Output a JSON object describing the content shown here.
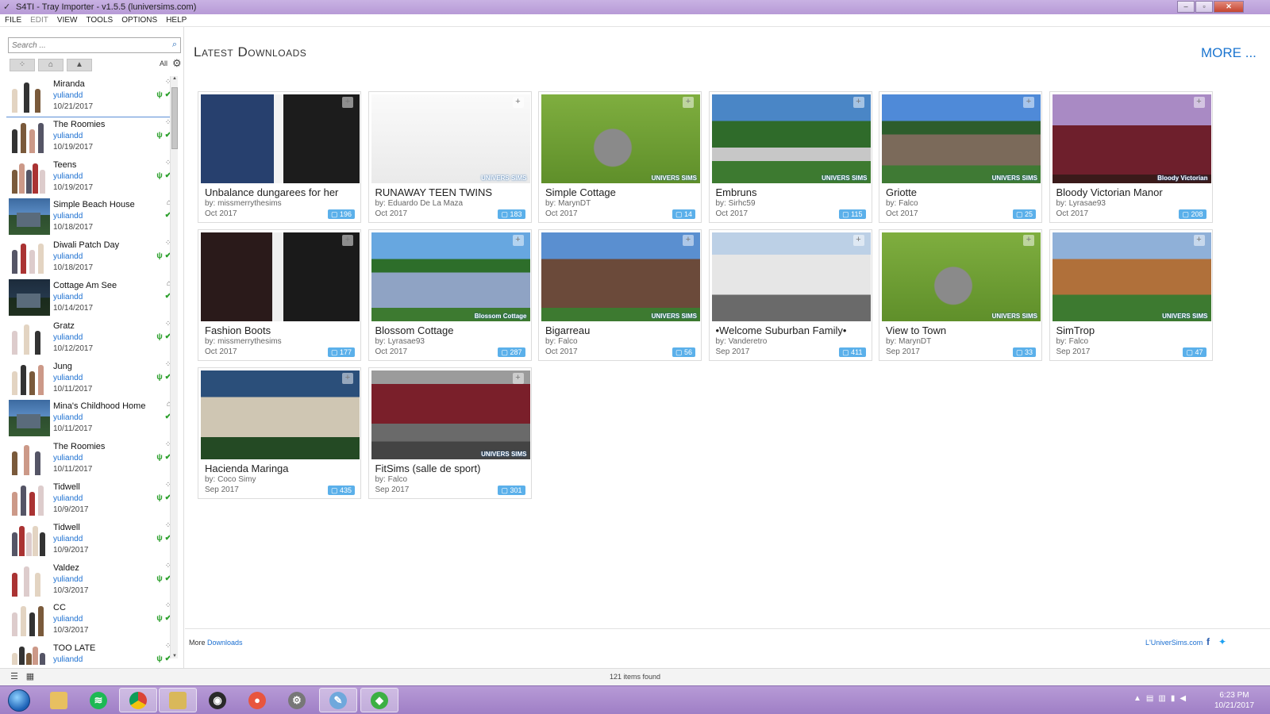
{
  "window": {
    "title": "S4TI - Tray Importer - v1.5.5  (luniversims.com)",
    "app_icon": "s4ti-icon",
    "controls": {
      "minimize": "–",
      "maximize": "▫",
      "close": "✕"
    }
  },
  "menu": [
    {
      "label": "FILE",
      "enabled": true
    },
    {
      "label": "EDIT",
      "enabled": false
    },
    {
      "label": "VIEW",
      "enabled": true
    },
    {
      "label": "TOOLS",
      "enabled": true
    },
    {
      "label": "OPTIONS",
      "enabled": true
    },
    {
      "label": "HELP",
      "enabled": true
    }
  ],
  "sidebar": {
    "search_placeholder": "Search ...",
    "filter_all": "All",
    "items": [
      {
        "name": "Miranda",
        "author": "yuliandd",
        "date": "10/21/2017",
        "type": "household",
        "cc": true
      },
      {
        "name": "The Roomies",
        "author": "yuliandd",
        "date": "10/19/2017",
        "type": "household",
        "cc": true
      },
      {
        "name": "Teens",
        "author": "yuliandd",
        "date": "10/19/2017",
        "type": "household",
        "cc": true
      },
      {
        "name": "Simple Beach House",
        "author": "yuliandd",
        "date": "10/18/2017",
        "type": "lot",
        "cc": true
      },
      {
        "name": "Diwali Patch Day",
        "author": "yuliandd",
        "date": "10/18/2017",
        "type": "household",
        "cc": true
      },
      {
        "name": "Cottage Am See",
        "author": "yuliandd",
        "date": "10/14/2017",
        "type": "lot",
        "cc": true
      },
      {
        "name": "Gratz",
        "author": "yuliandd",
        "date": "10/12/2017",
        "type": "household",
        "cc": true
      },
      {
        "name": "Jung",
        "author": "yuliandd",
        "date": "10/11/2017",
        "type": "household",
        "cc": true
      },
      {
        "name": "Mina's Childhood Home",
        "author": "yuliandd",
        "date": "10/11/2017",
        "type": "lot",
        "cc": true
      },
      {
        "name": "The Roomies",
        "author": "yuliandd",
        "date": "10/11/2017",
        "type": "household",
        "cc": true
      },
      {
        "name": "Tidwell",
        "author": "yuliandd",
        "date": "10/9/2017",
        "type": "household",
        "cc": true
      },
      {
        "name": "Tidwell",
        "author": "yuliandd",
        "date": "10/9/2017",
        "type": "household",
        "cc": true
      },
      {
        "name": "Valdez",
        "author": "yuliandd",
        "date": "10/3/2017",
        "type": "household",
        "cc": true
      },
      {
        "name": "CC",
        "author": "yuliandd",
        "date": "10/3/2017",
        "type": "household",
        "cc": true
      },
      {
        "name": "TOO LATE",
        "author": "yuliandd",
        "date": "",
        "type": "household",
        "cc": true
      }
    ]
  },
  "main": {
    "heading": "Latest Downloads",
    "more_label": "MORE ...",
    "cards": [
      {
        "title": "Unbalance dungarees for her",
        "by": "by: missmerrythesims",
        "date": "Oct 2017",
        "count": "196",
        "img": "cas",
        "watermark": ""
      },
      {
        "title": "RUNAWAY TEEN TWINS",
        "by": "by: Eduardo De La Maza",
        "date": "Oct 2017",
        "count": "183",
        "img": "sims",
        "watermark": "UNIVERS SIMS"
      },
      {
        "title": "Simple Cottage",
        "by": "by: MarynDT",
        "date": "Oct 2017",
        "count": "14",
        "img": "aerial",
        "watermark": "UNIVERS SIMS"
      },
      {
        "title": "Embruns",
        "by": "by: Sirhc59",
        "date": "Oct 2017",
        "count": "115",
        "img": "garden",
        "watermark": "UNIVERS SIMS"
      },
      {
        "title": "Griotte",
        "by": "by: Falco",
        "date": "Oct 2017",
        "count": "25",
        "img": "house",
        "watermark": "UNIVERS SIMS"
      },
      {
        "title": "Bloody Victorian Manor",
        "by": "by: Lyrasae93",
        "date": "Oct 2017",
        "count": "208",
        "img": "victorian",
        "watermark": "Bloody Victorian"
      },
      {
        "title": "Fashion Boots",
        "by": "by: missmerrythesims",
        "date": "Oct 2017",
        "count": "177",
        "img": "boots",
        "watermark": ""
      },
      {
        "title": "Blossom Cottage",
        "by": "by: Lyrasae93",
        "date": "Oct 2017",
        "count": "287",
        "img": "cottage",
        "watermark": "Blossom Cottage"
      },
      {
        "title": "Bigarreau",
        "by": "by: Falco",
        "date": "Oct 2017",
        "count": "56",
        "img": "barn",
        "watermark": "UNIVERS SIMS"
      },
      {
        "title": "•Welcome Suburban Family•",
        "by": "by: Vanderetro",
        "date": "Sep 2017",
        "count": "411",
        "img": "suburban",
        "watermark": ""
      },
      {
        "title": "View to Town",
        "by": "by: MarynDT",
        "date": "Sep 2017",
        "count": "33",
        "img": "aerial",
        "watermark": "UNIVERS SIMS"
      },
      {
        "title": "SimTrop",
        "by": "by: Falco",
        "date": "Sep 2017",
        "count": "47",
        "img": "modern",
        "watermark": "UNIVERS SIMS"
      },
      {
        "title": "Hacienda Maringa",
        "by": "by: Coco Simy",
        "date": "Sep 2017",
        "count": "435",
        "img": "hacienda",
        "watermark": ""
      },
      {
        "title": "FitSims (salle de sport)",
        "by": "by: Falco",
        "date": "Sep 2017",
        "count": "301",
        "img": "gym",
        "watermark": "UNIVERS SIMS"
      }
    ],
    "footer": {
      "more_prefix": "More",
      "downloads_link": "Downloads",
      "site": "L'UniverSims.com"
    }
  },
  "status": {
    "items_found": "121 items found"
  },
  "taskbar": {
    "apps": [
      "start-orb",
      "windows-explorer",
      "spotify",
      "chrome",
      "file-manager",
      "obs",
      "maps",
      "settings",
      "paint",
      "sims4-tray-importer"
    ],
    "clock_time": "6:23 PM",
    "clock_date": "10/21/2017"
  },
  "colors": {
    "accent": "#1b75d0",
    "badge": "#5bb0ea",
    "cc_check": "#2ca02c",
    "titlebar": "#c9b2e3"
  }
}
